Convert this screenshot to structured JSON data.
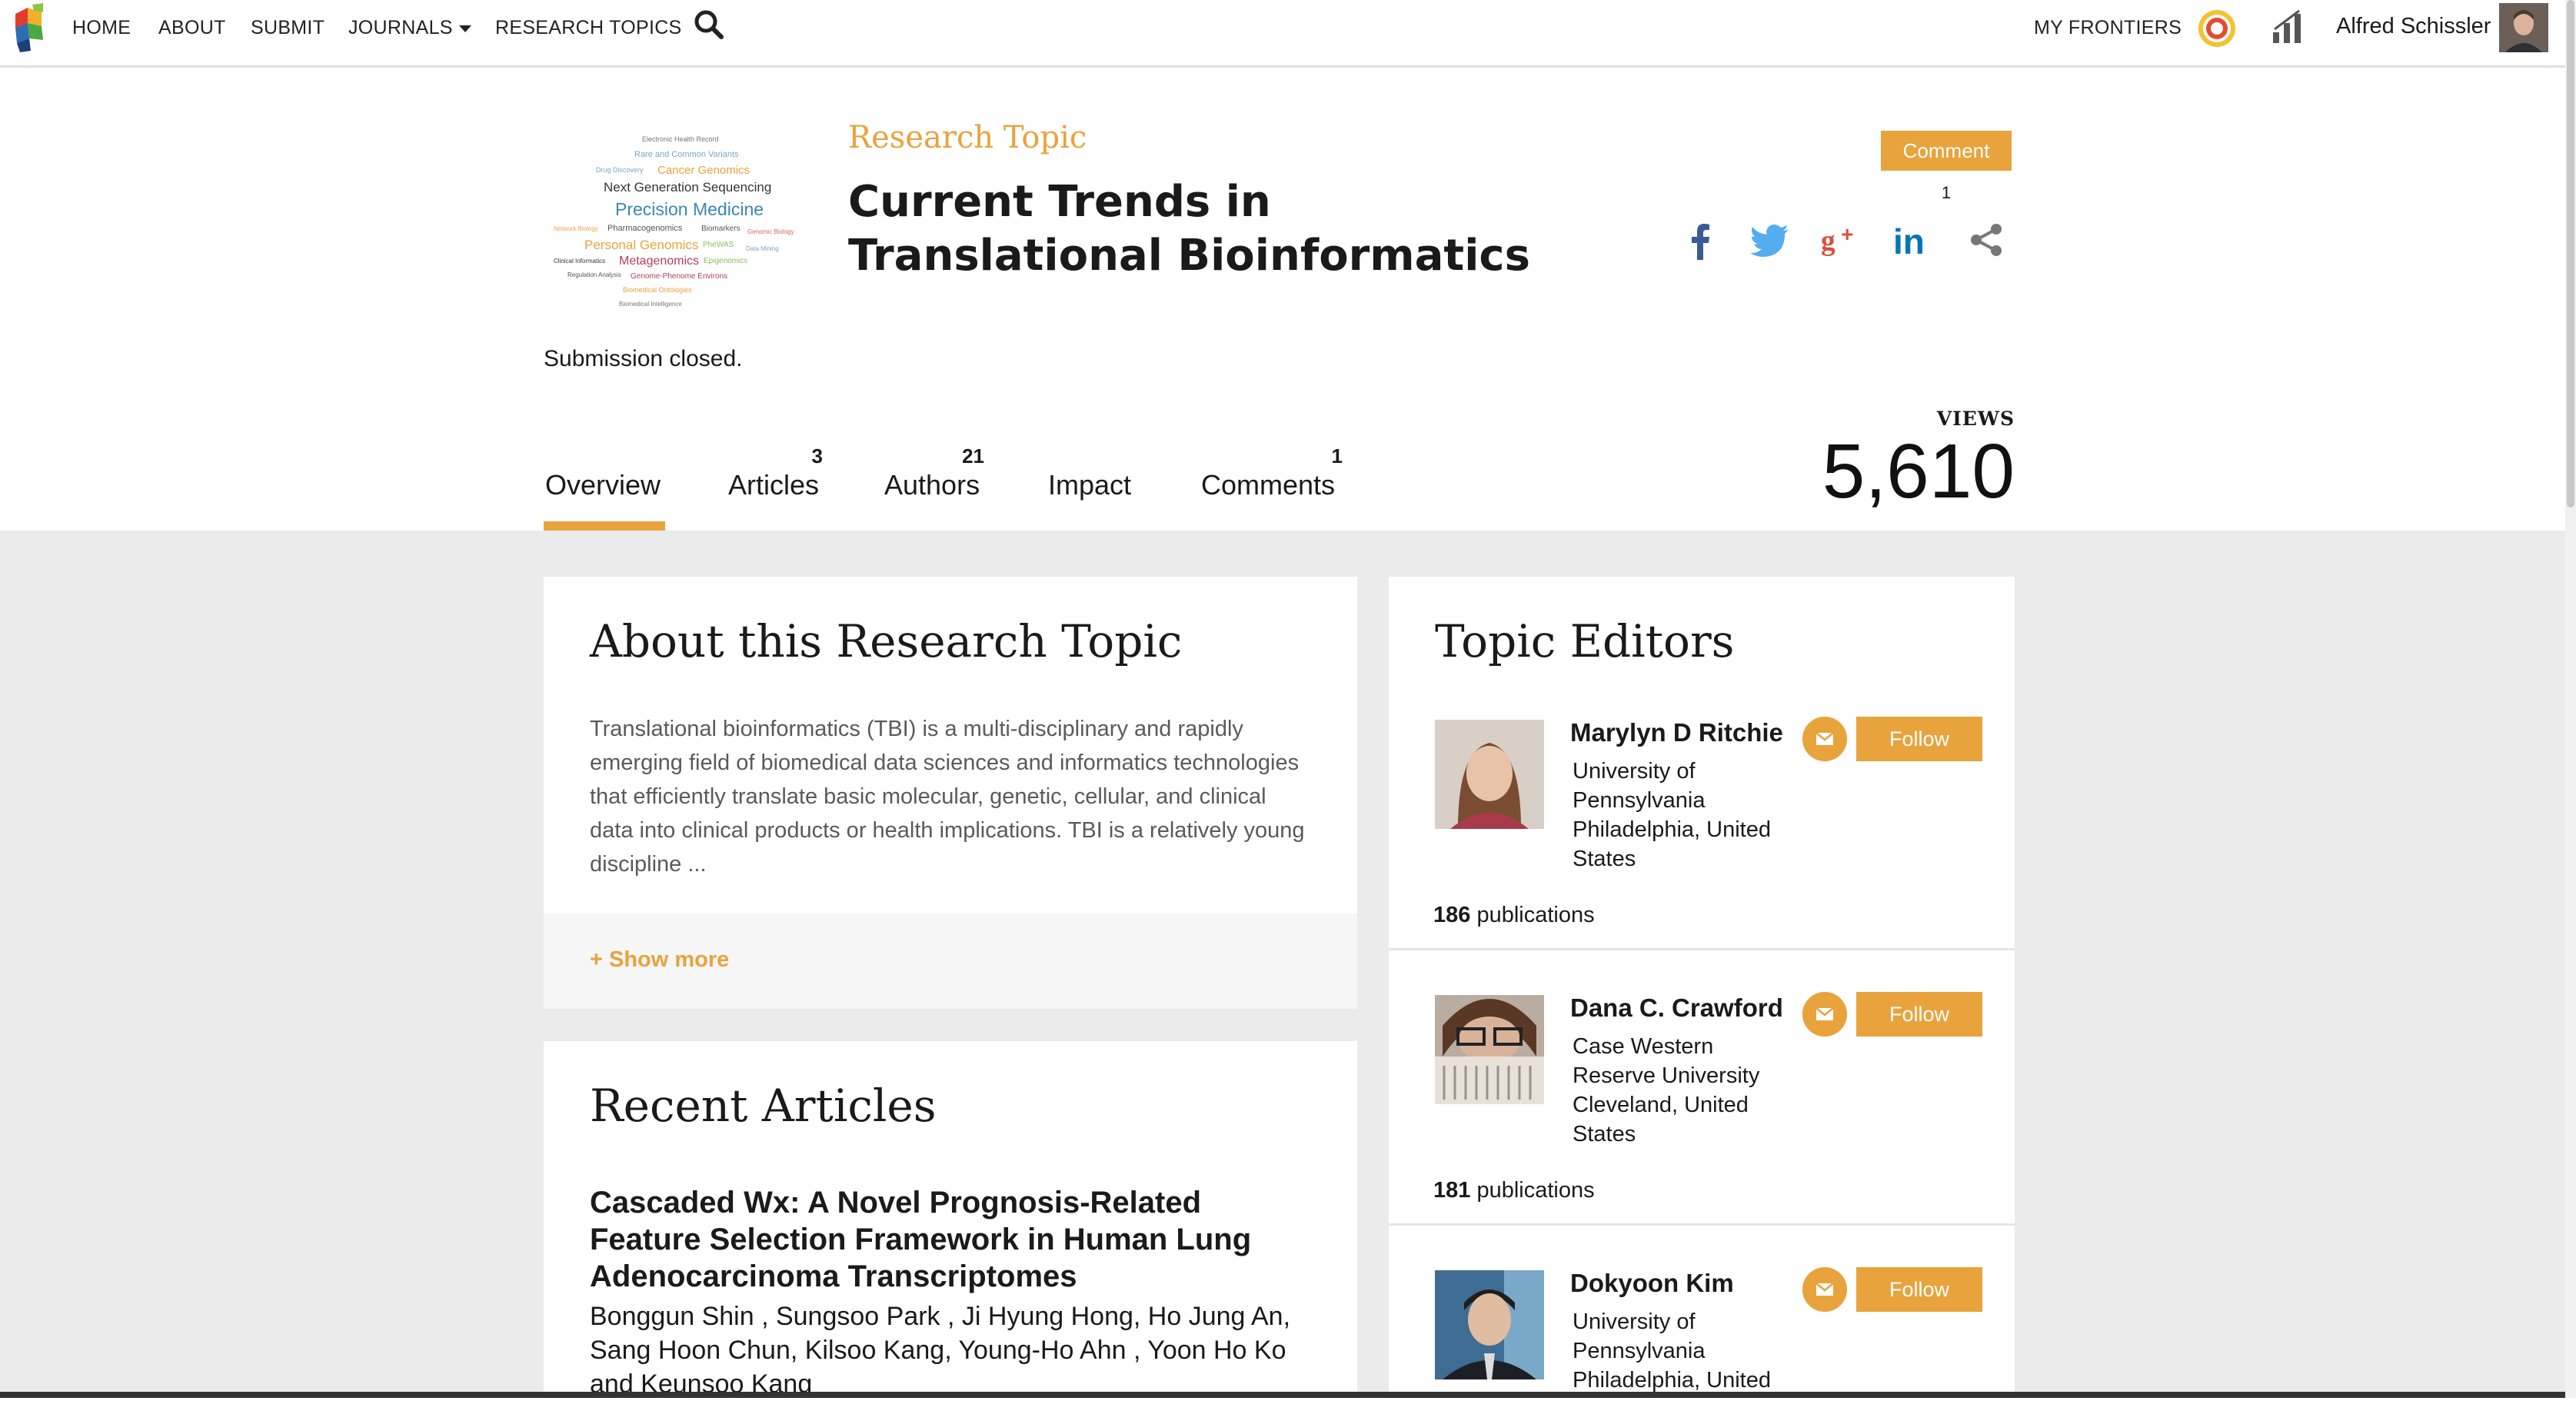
{
  "nav": {
    "items": [
      "HOME",
      "ABOUT",
      "SUBMIT",
      "JOURNALS",
      "RESEARCH TOPICS"
    ],
    "my_frontiers": "MY FRONTIERS",
    "user_name": "Alfred Schissler"
  },
  "header": {
    "label": "Research Topic",
    "title": "Current Trends in Translational Bioinformatics",
    "comment_button": "Comment",
    "comment_count": "1",
    "submission_status": "Submission closed."
  },
  "word_cloud": [
    "Electronic Health Record",
    "Rare and Common Variants",
    "Drug Discovery",
    "Cancer Genomics",
    "Next Generation Sequencing",
    "Precision Medicine",
    "Network Biology",
    "Pharmacogenomics",
    "Biomarkers",
    "Genomic Biology",
    "Personal Genomics",
    "PheWAS",
    "Data Mining",
    "Clinical Informatics",
    "Metagenomics",
    "Epigenomics",
    "Regulation Analysis",
    "Genome-Phenome Environs",
    "Biomedical Ontologies",
    "Biomedical Intelligence"
  ],
  "tabs": [
    {
      "label": "Overview",
      "count": ""
    },
    {
      "label": "Articles",
      "count": "3"
    },
    {
      "label": "Authors",
      "count": "21"
    },
    {
      "label": "Impact",
      "count": ""
    },
    {
      "label": "Comments",
      "count": "1"
    }
  ],
  "views": {
    "label": "VIEWS",
    "value": "5,610"
  },
  "about": {
    "title": "About this Research Topic",
    "text": "Translational bioinformatics (TBI) is a multi-disciplinary and rapidly emerging field of biomedical data sciences and informatics technologies that efficiently translate basic molecular, genetic, cellular, and clinical data into clinical products or health implications. TBI is a relatively young discipline ...",
    "show_more": "+ Show more"
  },
  "recent": {
    "title": "Recent Articles",
    "article_title": "Cascaded Wx: A Novel Prognosis-Related Feature Selection Framework in Human Lung Adenocarcinoma Transcriptomes",
    "authors_line1": "Bonggun Shin , Sungsoo Park , Ji Hyung Hong, Ho Jung An,",
    "authors_line2": "Sang Hoon Chun, Kilsoo Kang, Young-Ho Ahn , Yoon Ho Ko",
    "authors_line3": "and Keunsoo Kang"
  },
  "editors": {
    "title": "Topic Editors",
    "follow_label": "Follow",
    "list": [
      {
        "name": "Marylyn D Ritchie",
        "affil1": "University of",
        "affil2": "Pennsylvania",
        "affil3": "Philadelphia, United",
        "affil4": "States",
        "pubs": "186",
        "pubs_label": " publications"
      },
      {
        "name": "Dana C. Crawford",
        "affil1": "Case Western",
        "affil2": "Reserve University",
        "affil3": "Cleveland, United",
        "affil4": "States",
        "pubs": "181",
        "pubs_label": " publications"
      },
      {
        "name": "Dokyoon Kim",
        "affil1": "University of",
        "affil2": "Pennsylvania",
        "affil3": "Philadelphia, United",
        "affil4": "",
        "pubs": "",
        "pubs_label": ""
      }
    ]
  },
  "colors": {
    "accent": "#e8a33c",
    "background": "#ebebeb"
  },
  "icons": [
    "frontiers-logo",
    "search-icon",
    "loop-icon",
    "impact-chart-icon",
    "facebook-icon",
    "twitter-icon",
    "google-plus-icon",
    "linkedin-icon",
    "share-icon",
    "mail-icon"
  ]
}
